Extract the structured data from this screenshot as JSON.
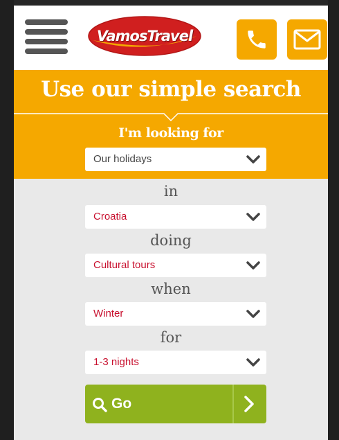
{
  "header": {
    "logo_text": "VamosTravel",
    "menu_icon": "hamburger-icon",
    "phone_icon": "phone-icon",
    "mail_icon": "mail-icon",
    "brand_color": "#f5a800",
    "logo_color": "#d01f1f"
  },
  "search": {
    "title": "Use our simple search",
    "looking_label": "I'm looking for",
    "looking_value": "Our holidays",
    "in_label": "in",
    "in_value": "Croatia",
    "doing_label": "doing",
    "doing_value": "Cultural tours",
    "when_label": "when",
    "when_value": "Winter",
    "for_label": "for",
    "for_value": "1-3 nights",
    "go_label": "Go",
    "go_icon": "search-icon",
    "go_arrow_icon": "chevron-right-icon",
    "go_color": "#8fb21e",
    "value_color": "#c8102e"
  }
}
